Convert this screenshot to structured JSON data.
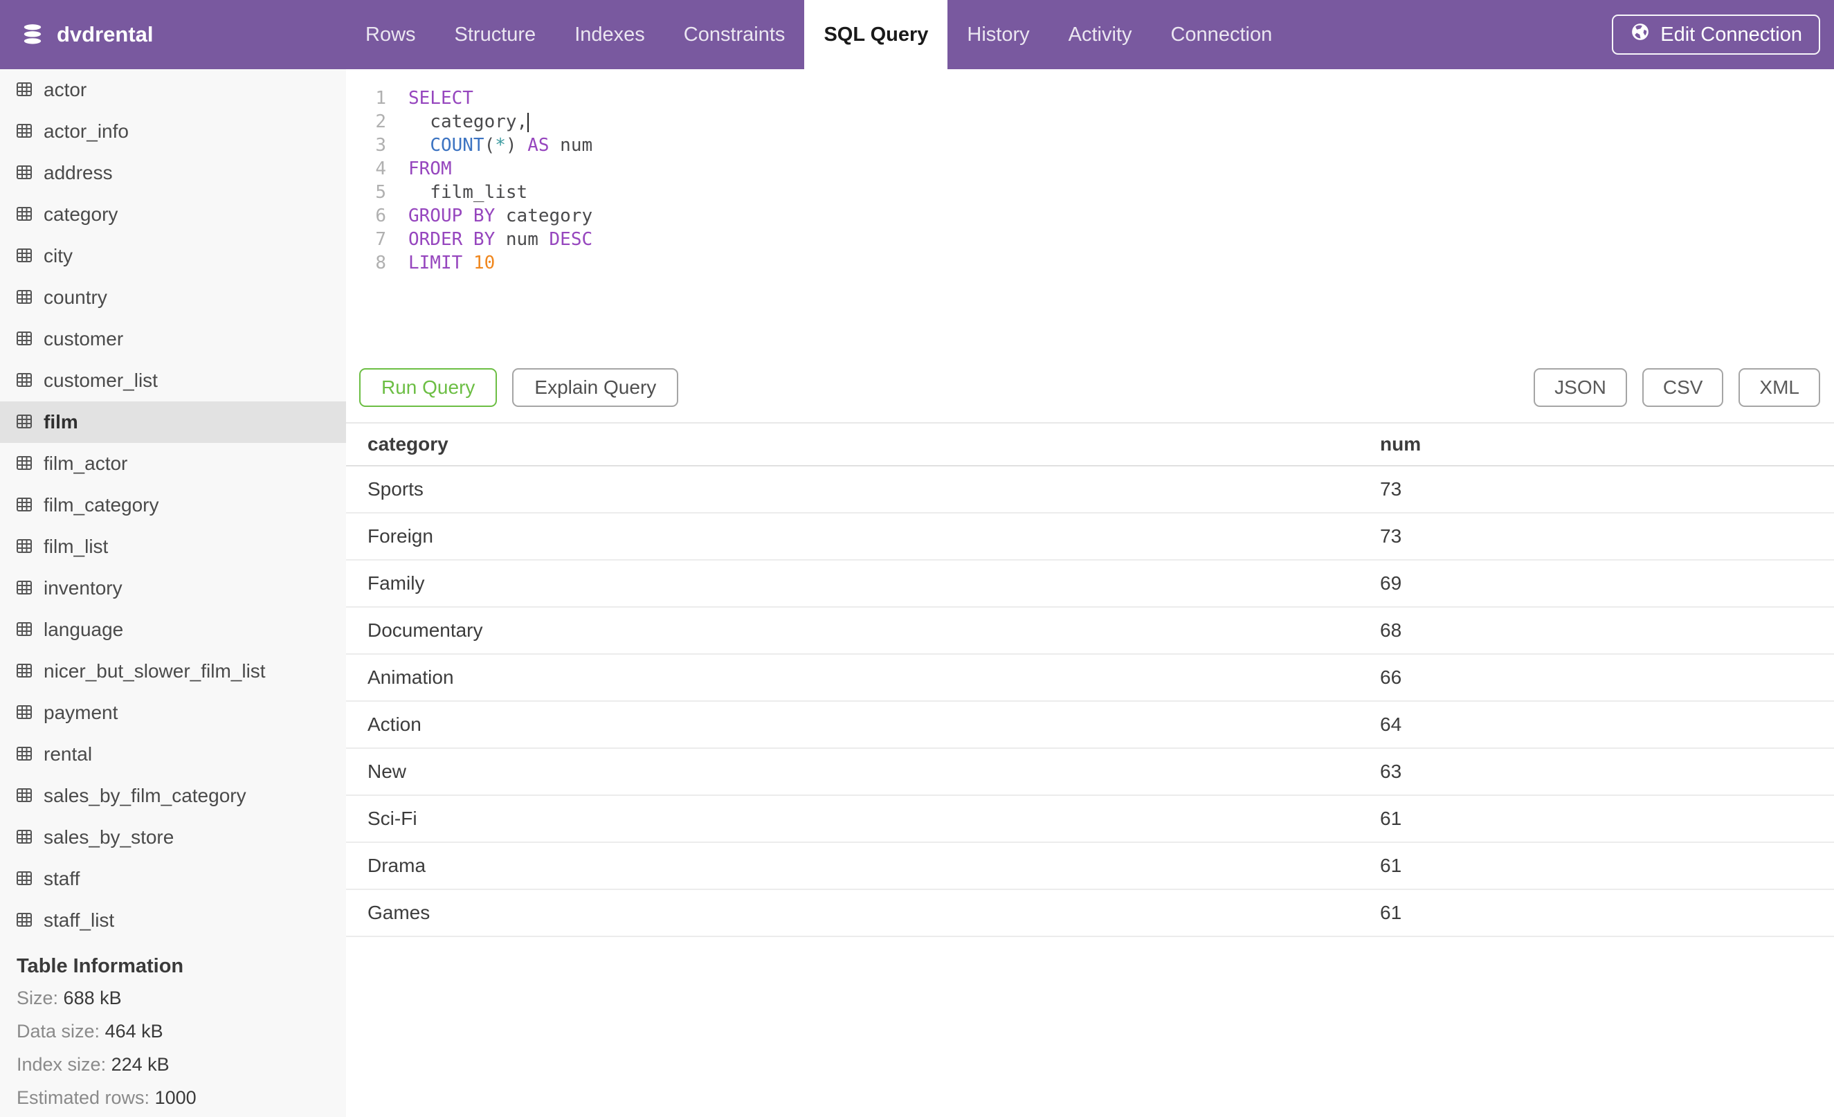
{
  "header": {
    "database": "dvdrental",
    "tabs": [
      {
        "label": "Rows"
      },
      {
        "label": "Structure"
      },
      {
        "label": "Indexes"
      },
      {
        "label": "Constraints"
      },
      {
        "label": "SQL Query",
        "active": true
      },
      {
        "label": "History"
      },
      {
        "label": "Activity"
      },
      {
        "label": "Connection"
      }
    ],
    "edit_connection_label": "Edit Connection"
  },
  "sidebar": {
    "items": [
      {
        "label": "actor"
      },
      {
        "label": "actor_info"
      },
      {
        "label": "address"
      },
      {
        "label": "category"
      },
      {
        "label": "city"
      },
      {
        "label": "country"
      },
      {
        "label": "customer"
      },
      {
        "label": "customer_list"
      },
      {
        "label": "film",
        "selected": true
      },
      {
        "label": "film_actor"
      },
      {
        "label": "film_category"
      },
      {
        "label": "film_list"
      },
      {
        "label": "inventory"
      },
      {
        "label": "language"
      },
      {
        "label": "nicer_but_slower_film_list"
      },
      {
        "label": "payment"
      },
      {
        "label": "rental"
      },
      {
        "label": "sales_by_film_category"
      },
      {
        "label": "sales_by_store"
      },
      {
        "label": "staff"
      },
      {
        "label": "staff_list"
      }
    ],
    "table_information": {
      "title": "Table Information",
      "rows": [
        {
          "label": "Size:",
          "value": "688 kB"
        },
        {
          "label": "Data size:",
          "value": "464 kB"
        },
        {
          "label": "Index size:",
          "value": "224 kB"
        },
        {
          "label": "Estimated rows:",
          "value": "1000"
        }
      ]
    }
  },
  "editor": {
    "lines": [
      {
        "num": "1",
        "tokens": [
          {
            "v": "SELECT"
          }
        ]
      },
      {
        "num": "2",
        "tokens": [
          {
            "v": "  category,"
          }
        ]
      },
      {
        "num": "3",
        "tokens": [
          {
            "v": "  "
          },
          {
            "v": "COUNT"
          },
          {
            "v": "("
          },
          {
            "v": "*"
          },
          {
            "v": ") "
          },
          {
            "v": "AS"
          },
          {
            "v": " num"
          }
        ]
      },
      {
        "num": "4",
        "tokens": [
          {
            "v": "FROM"
          }
        ]
      },
      {
        "num": "5",
        "tokens": [
          {
            "v": "  film_list"
          }
        ]
      },
      {
        "num": "6",
        "tokens": [
          {
            "v": "GROUP BY"
          },
          {
            "v": " category"
          }
        ]
      },
      {
        "num": "7",
        "tokens": [
          {
            "v": "ORDER BY"
          },
          {
            "v": " num "
          },
          {
            "v": "DESC"
          }
        ]
      },
      {
        "num": "8",
        "tokens": [
          {
            "v": "LIMIT"
          },
          {
            "v": " "
          },
          {
            "v": "10"
          }
        ]
      }
    ]
  },
  "actions": {
    "run_label": "Run Query",
    "explain_label": "Explain Query",
    "export": [
      {
        "label": "JSON"
      },
      {
        "label": "CSV"
      },
      {
        "label": "XML"
      }
    ]
  },
  "results": {
    "columns": [
      "category",
      "num"
    ],
    "rows": [
      [
        "Sports",
        "73"
      ],
      [
        "Foreign",
        "73"
      ],
      [
        "Family",
        "69"
      ],
      [
        "Documentary",
        "68"
      ],
      [
        "Animation",
        "66"
      ],
      [
        "Action",
        "64"
      ],
      [
        "New",
        "63"
      ],
      [
        "Sci-Fi",
        "61"
      ],
      [
        "Drama",
        "61"
      ],
      [
        "Games",
        "61"
      ]
    ]
  },
  "colors": {
    "header_purple": "#79599F",
    "run_green": "#6CBE44",
    "sql_keyword": "#9646BE",
    "sql_builtin": "#3D74C2",
    "sql_operator": "#3C9BA0",
    "sql_number": "#F0871E",
    "sidebar_bg": "#F8F8F8",
    "selected_row_bg": "#E2E2E2"
  }
}
